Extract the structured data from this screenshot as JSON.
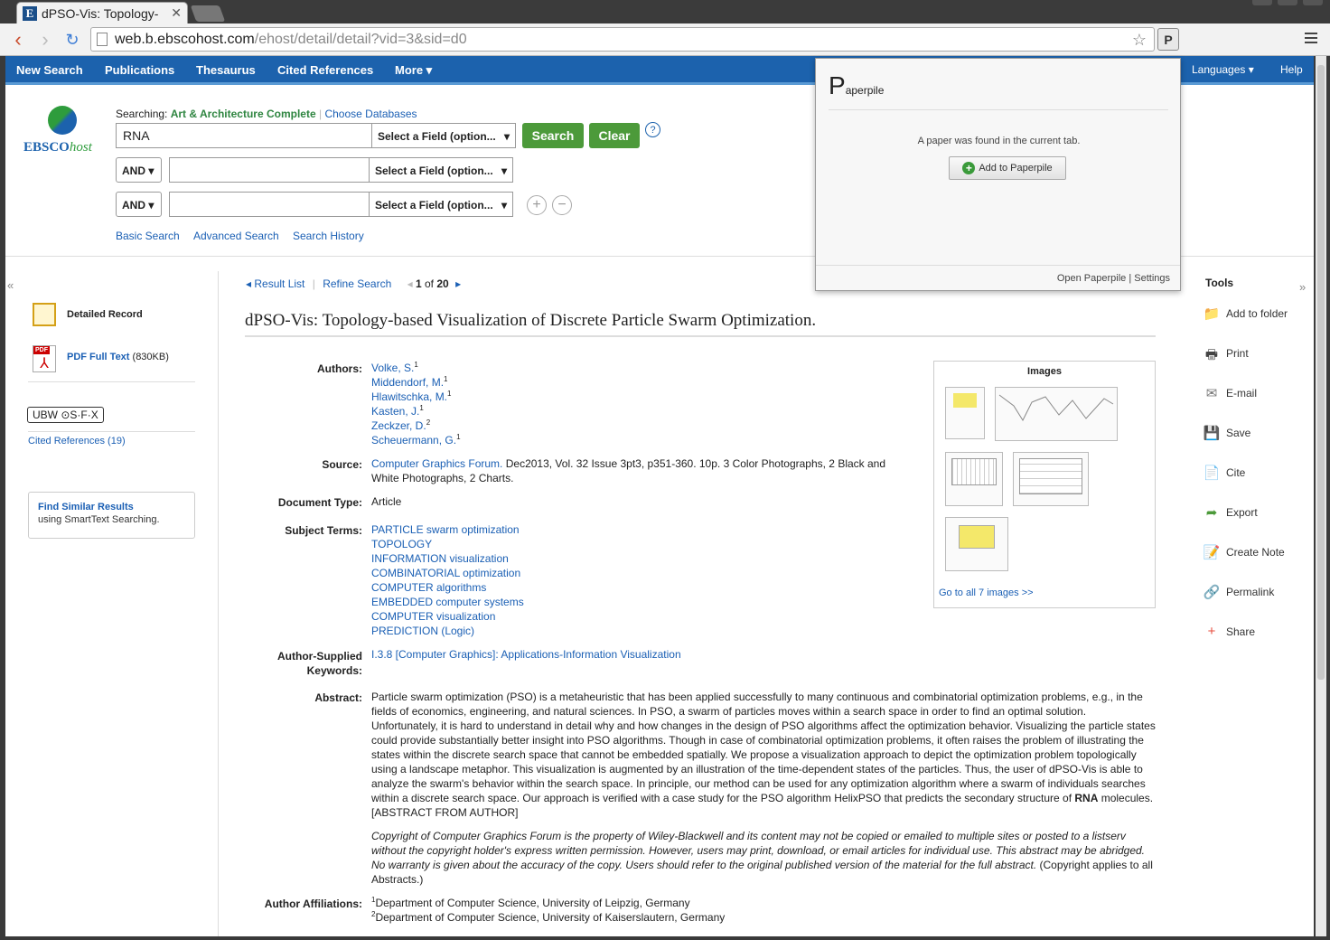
{
  "browser": {
    "tab_title": "dPSO-Vis: Topology-",
    "favicon_letter": "E",
    "url_host": "web.b.ebscohost.com",
    "url_path": "/ehost/detail/detail?vid=3&sid=d0",
    "extension_letter": "P"
  },
  "nav": {
    "items": [
      "New Search",
      "Publications",
      "Thesaurus",
      "Cited References",
      "More ▾"
    ],
    "right_items": [
      "Languages ▾",
      "Help"
    ]
  },
  "logo": {
    "brand": "EBSCO",
    "brand_italic": "host"
  },
  "search": {
    "searching_label": "Searching:",
    "database": "Art & Architecture Complete",
    "choose_db": "Choose Databases",
    "query": "RNA",
    "field_placeholder": "Select a Field (option...",
    "bool_op": "AND",
    "search_btn": "Search",
    "clear_btn": "Clear",
    "help": "?",
    "links": [
      "Basic Search",
      "Advanced Search",
      "Search History"
    ]
  },
  "left": {
    "detailed_record": "Detailed Record",
    "pdf_label": "PDF Full Text",
    "pdf_size": "(830KB)",
    "sfx": "UBW ⊙S·F·X",
    "cited_refs": "Cited References (19)",
    "find_similar": "Find Similar Results",
    "find_similar_sub": "using SmartText Searching."
  },
  "result_nav": {
    "result_list": "Result List",
    "refine": "Refine Search",
    "position": "1",
    "of_text": "of",
    "total": "20"
  },
  "article": {
    "title": "dPSO-Vis: Topology-based Visualization of Discrete Particle Swarm Optimization.",
    "labels": {
      "authors": "Authors:",
      "source": "Source:",
      "doctype": "Document Type:",
      "subjects": "Subject Terms:",
      "keywords": "Author-Supplied Keywords:",
      "abstract": "Abstract:",
      "affiliations": "Author Affiliations:"
    },
    "authors": [
      {
        "name": "Volke, S.",
        "sup": "1"
      },
      {
        "name": "Middendorf, M.",
        "sup": "1"
      },
      {
        "name": "Hlawitschka, M.",
        "sup": "1"
      },
      {
        "name": "Kasten, J.",
        "sup": "1"
      },
      {
        "name": "Zeckzer, D.",
        "sup": "2"
      },
      {
        "name": "Scheuermann, G.",
        "sup": "1"
      }
    ],
    "source_link": "Computer Graphics Forum.",
    "source_rest": " Dec2013, Vol. 32 Issue 3pt3, p351-360. 10p. 3 Color Photographs, 2 Black and White Photographs, 2 Charts.",
    "doctype": "Article",
    "subjects": [
      "PARTICLE swarm optimization",
      "TOPOLOGY",
      "INFORMATION visualization",
      "COMBINATORIAL optimization",
      "COMPUTER algorithms",
      "EMBEDDED computer systems",
      "COMPUTER visualization",
      "PREDICTION (Logic)"
    ],
    "keyword": "I.3.8 [Computer Graphics]: Applications-Information Visualization",
    "abstract_a": "Particle swarm optimization (PSO) is a metaheuristic that has been applied successfully to many continuous and combinatorial optimization problems, e.g., in the fields of economics, engineering, and natural sciences. In PSO, a swarm of particles moves within a search space in order to find an optimal solution. Unfortunately, it is hard to understand in detail why and how changes in the design of PSO algorithms affect the optimization behavior. Visualizing the particle states could provide substantially better insight into PSO algorithms. Though in case of combinatorial optimization problems, it often raises the problem of illustrating the states within the discrete search space that cannot be embedded spatially. We propose a visualization approach to depict the optimization problem topologically using a landscape metaphor. This visualization is augmented by an illustration of the time-dependent states of the particles. Thus, the user of dPSO-Vis is able to analyze the swarm's behavior within the search space. In principle, our method can be used for any optimization algorithm where a swarm of individuals searches within a discrete search space. Our approach is verified with a case study for the PSO algorithm HelixPSO that predicts the secondary structure of ",
    "abstract_bold": "RNA",
    "abstract_b": " molecules. [ABSTRACT FROM AUTHOR]",
    "copyright_italic": "Copyright of Computer Graphics Forum is the property of Wiley-Blackwell and its content may not be copied or emailed to multiple sites or posted to a listserv without the copyright holder's express written permission. However, users may print, download, or email articles for individual use. This abstract may be abridged. No warranty is given about the accuracy of the copy. Users should refer to the original published version of the material for the full abstract.",
    "copyright_normal": " (Copyright applies to all Abstracts.)",
    "affiliations": [
      {
        "sup": "1",
        "text": "Department of Computer Science, University of Leipzig, Germany"
      },
      {
        "sup": "2",
        "text": "Department of Computer Science, University of Kaiserslautern, Germany"
      }
    ]
  },
  "images_box": {
    "title": "Images",
    "link": "Go to all 7 images >>"
  },
  "tools": {
    "title": "Tools",
    "items": [
      "Add to folder",
      "Print",
      "E-mail",
      "Save",
      "Cite",
      "Export",
      "Create Note",
      "Permalink",
      "Share"
    ]
  },
  "paperpile": {
    "logo_p": "P",
    "logo_rest": "aperpile",
    "message": "A paper was found in the current tab.",
    "add_btn": "Add to Paperpile",
    "open_link": "Open Paperpile",
    "settings_link": "Settings",
    "separator": "|"
  },
  "colors": {
    "nav_blue": "#1c62ad",
    "green": "#4c9a3a",
    "link": "#1a5fb4"
  }
}
